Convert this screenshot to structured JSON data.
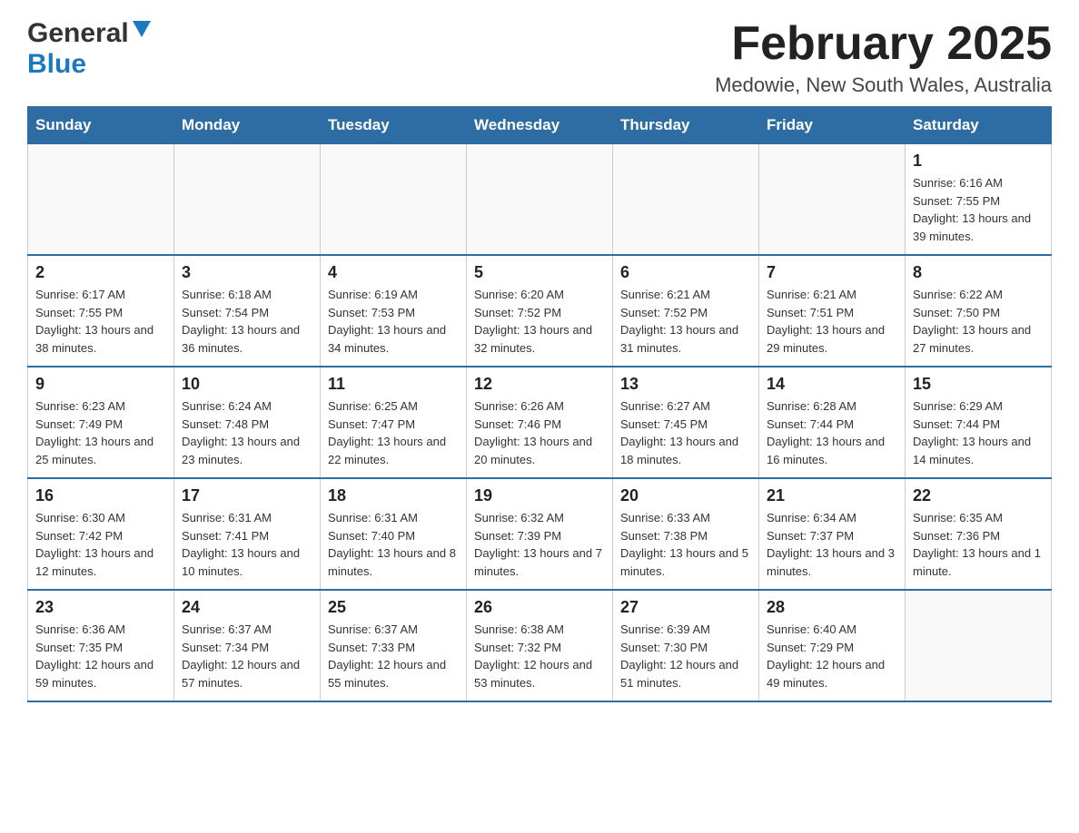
{
  "header": {
    "logo_general": "General",
    "logo_blue": "Blue",
    "title": "February 2025",
    "subtitle": "Medowie, New South Wales, Australia"
  },
  "days_of_week": [
    "Sunday",
    "Monday",
    "Tuesday",
    "Wednesday",
    "Thursday",
    "Friday",
    "Saturday"
  ],
  "weeks": [
    [
      {
        "date": "",
        "info": ""
      },
      {
        "date": "",
        "info": ""
      },
      {
        "date": "",
        "info": ""
      },
      {
        "date": "",
        "info": ""
      },
      {
        "date": "",
        "info": ""
      },
      {
        "date": "",
        "info": ""
      },
      {
        "date": "1",
        "info": "Sunrise: 6:16 AM\nSunset: 7:55 PM\nDaylight: 13 hours and 39 minutes."
      }
    ],
    [
      {
        "date": "2",
        "info": "Sunrise: 6:17 AM\nSunset: 7:55 PM\nDaylight: 13 hours and 38 minutes."
      },
      {
        "date": "3",
        "info": "Sunrise: 6:18 AM\nSunset: 7:54 PM\nDaylight: 13 hours and 36 minutes."
      },
      {
        "date": "4",
        "info": "Sunrise: 6:19 AM\nSunset: 7:53 PM\nDaylight: 13 hours and 34 minutes."
      },
      {
        "date": "5",
        "info": "Sunrise: 6:20 AM\nSunset: 7:52 PM\nDaylight: 13 hours and 32 minutes."
      },
      {
        "date": "6",
        "info": "Sunrise: 6:21 AM\nSunset: 7:52 PM\nDaylight: 13 hours and 31 minutes."
      },
      {
        "date": "7",
        "info": "Sunrise: 6:21 AM\nSunset: 7:51 PM\nDaylight: 13 hours and 29 minutes."
      },
      {
        "date": "8",
        "info": "Sunrise: 6:22 AM\nSunset: 7:50 PM\nDaylight: 13 hours and 27 minutes."
      }
    ],
    [
      {
        "date": "9",
        "info": "Sunrise: 6:23 AM\nSunset: 7:49 PM\nDaylight: 13 hours and 25 minutes."
      },
      {
        "date": "10",
        "info": "Sunrise: 6:24 AM\nSunset: 7:48 PM\nDaylight: 13 hours and 23 minutes."
      },
      {
        "date": "11",
        "info": "Sunrise: 6:25 AM\nSunset: 7:47 PM\nDaylight: 13 hours and 22 minutes."
      },
      {
        "date": "12",
        "info": "Sunrise: 6:26 AM\nSunset: 7:46 PM\nDaylight: 13 hours and 20 minutes."
      },
      {
        "date": "13",
        "info": "Sunrise: 6:27 AM\nSunset: 7:45 PM\nDaylight: 13 hours and 18 minutes."
      },
      {
        "date": "14",
        "info": "Sunrise: 6:28 AM\nSunset: 7:44 PM\nDaylight: 13 hours and 16 minutes."
      },
      {
        "date": "15",
        "info": "Sunrise: 6:29 AM\nSunset: 7:44 PM\nDaylight: 13 hours and 14 minutes."
      }
    ],
    [
      {
        "date": "16",
        "info": "Sunrise: 6:30 AM\nSunset: 7:42 PM\nDaylight: 13 hours and 12 minutes."
      },
      {
        "date": "17",
        "info": "Sunrise: 6:31 AM\nSunset: 7:41 PM\nDaylight: 13 hours and 10 minutes."
      },
      {
        "date": "18",
        "info": "Sunrise: 6:31 AM\nSunset: 7:40 PM\nDaylight: 13 hours and 8 minutes."
      },
      {
        "date": "19",
        "info": "Sunrise: 6:32 AM\nSunset: 7:39 PM\nDaylight: 13 hours and 7 minutes."
      },
      {
        "date": "20",
        "info": "Sunrise: 6:33 AM\nSunset: 7:38 PM\nDaylight: 13 hours and 5 minutes."
      },
      {
        "date": "21",
        "info": "Sunrise: 6:34 AM\nSunset: 7:37 PM\nDaylight: 13 hours and 3 minutes."
      },
      {
        "date": "22",
        "info": "Sunrise: 6:35 AM\nSunset: 7:36 PM\nDaylight: 13 hours and 1 minute."
      }
    ],
    [
      {
        "date": "23",
        "info": "Sunrise: 6:36 AM\nSunset: 7:35 PM\nDaylight: 12 hours and 59 minutes."
      },
      {
        "date": "24",
        "info": "Sunrise: 6:37 AM\nSunset: 7:34 PM\nDaylight: 12 hours and 57 minutes."
      },
      {
        "date": "25",
        "info": "Sunrise: 6:37 AM\nSunset: 7:33 PM\nDaylight: 12 hours and 55 minutes."
      },
      {
        "date": "26",
        "info": "Sunrise: 6:38 AM\nSunset: 7:32 PM\nDaylight: 12 hours and 53 minutes."
      },
      {
        "date": "27",
        "info": "Sunrise: 6:39 AM\nSunset: 7:30 PM\nDaylight: 12 hours and 51 minutes."
      },
      {
        "date": "28",
        "info": "Sunrise: 6:40 AM\nSunset: 7:29 PM\nDaylight: 12 hours and 49 minutes."
      },
      {
        "date": "",
        "info": ""
      }
    ]
  ]
}
